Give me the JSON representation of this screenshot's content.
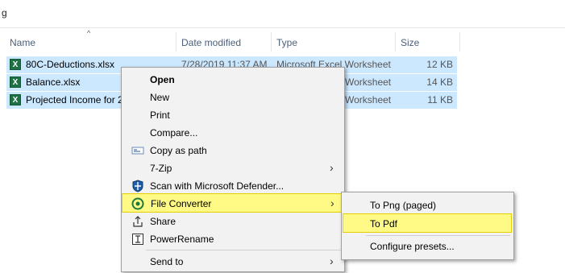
{
  "path_fragment": "g",
  "columns": {
    "name": "Name",
    "date": "Date modified",
    "type": "Type",
    "size": "Size"
  },
  "files": [
    {
      "name": "80C-Deductions.xlsx",
      "date": "7/28/2019 11:37 AM",
      "type": "Microsoft Excel Worksheet",
      "size": "12 KB"
    },
    {
      "name": "Balance.xlsx",
      "date": "",
      "type": "Worksheet",
      "size": "14 KB"
    },
    {
      "name": "Projected Income for 2",
      "date": "",
      "type": "Worksheet",
      "size": "11 KB"
    }
  ],
  "context_menu": {
    "open": "Open",
    "new": "New",
    "print": "Print",
    "compare": "Compare...",
    "copy_path": "Copy as path",
    "seven_zip": "7-Zip",
    "defender": "Scan with Microsoft Defender...",
    "file_converter": "File Converter",
    "share": "Share",
    "powerrename": "PowerRename",
    "send_to": "Send to"
  },
  "submenu": {
    "to_png": "To Png (paged)",
    "to_pdf": "To Pdf",
    "configure": "Configure presets..."
  },
  "icons": {
    "file": "excel-file-icon",
    "copy_path": "copy-path-icon",
    "defender": "defender-shield-icon",
    "file_converter": "file-converter-icon",
    "share": "share-icon",
    "powerrename": "powerrename-icon",
    "submenu_arrow": "chevron-right-icon"
  },
  "colors": {
    "selection": "#cce8ff",
    "highlight": "#fff985",
    "highlight_border": "#e5cf00"
  }
}
